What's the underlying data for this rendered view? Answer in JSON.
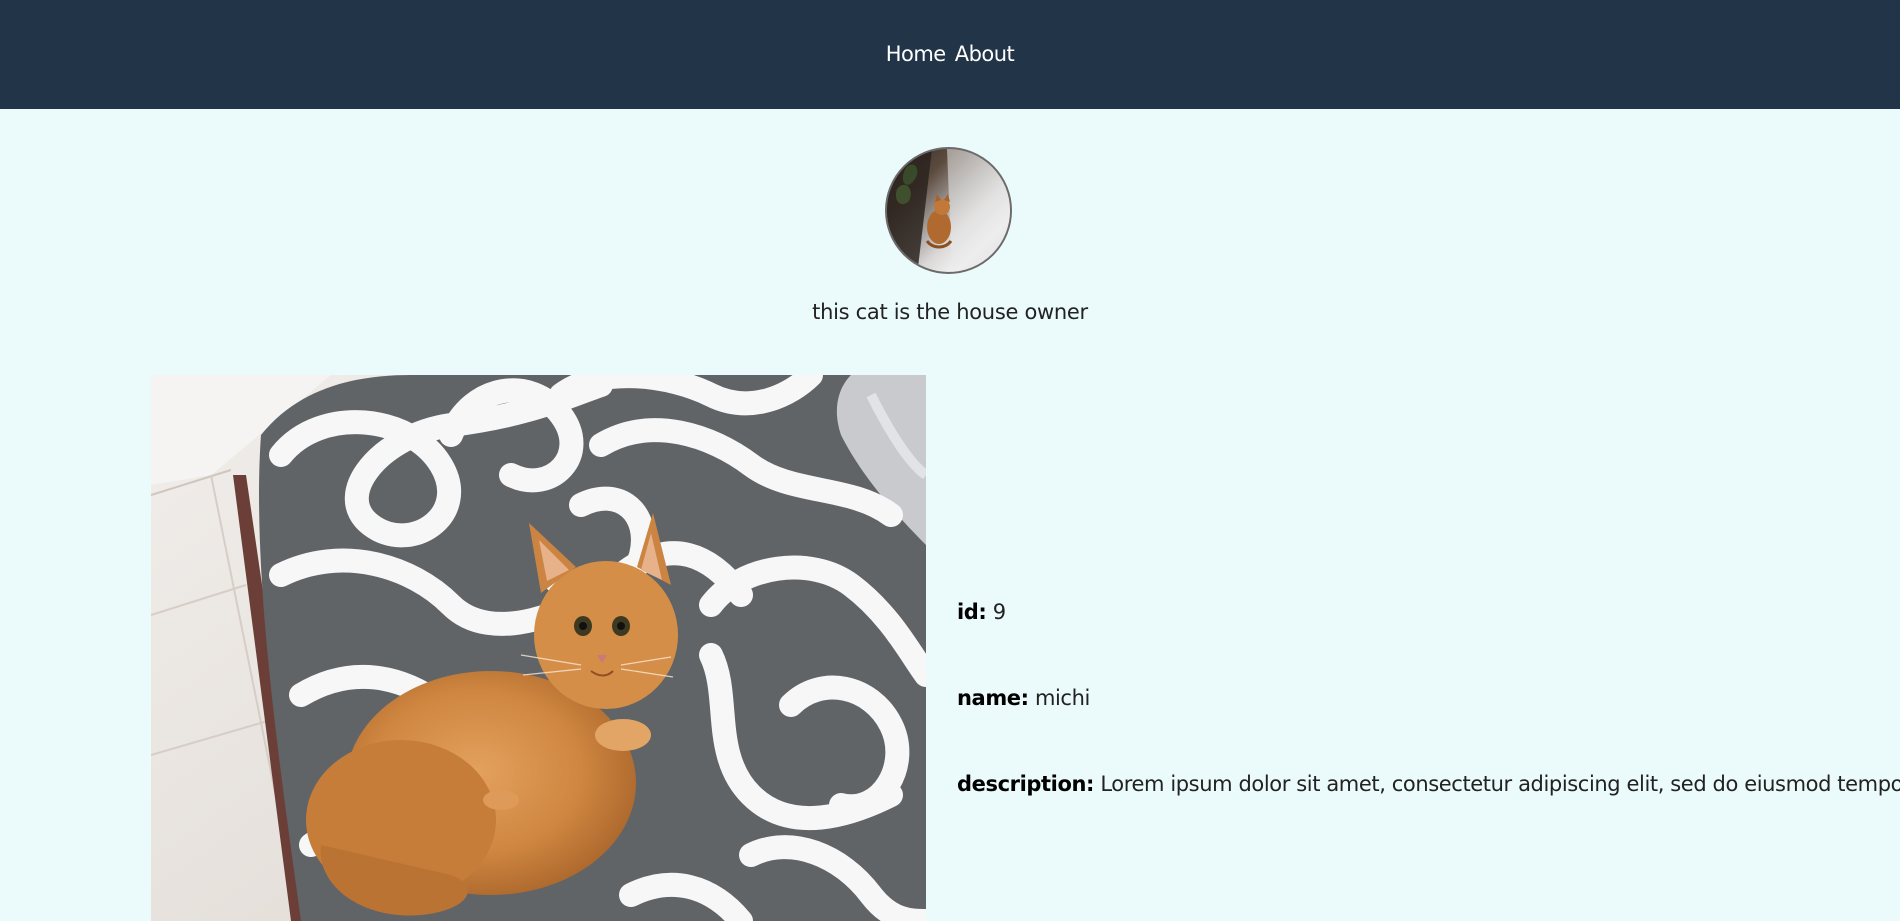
{
  "nav": {
    "links": [
      "Home",
      "About"
    ]
  },
  "profile": {
    "caption": "this cat is the house owner"
  },
  "details": {
    "id_label": "id:",
    "id_value": "9",
    "name_label": "name:",
    "name_value": "michi",
    "description_label": "description:",
    "description_value": "Lorem ipsum dolor sit amet, consectetur adipiscing elit, sed do eiusmod tempor...."
  },
  "colors": {
    "nav_bg": "#223447",
    "page_bg": "#ebfafa"
  }
}
